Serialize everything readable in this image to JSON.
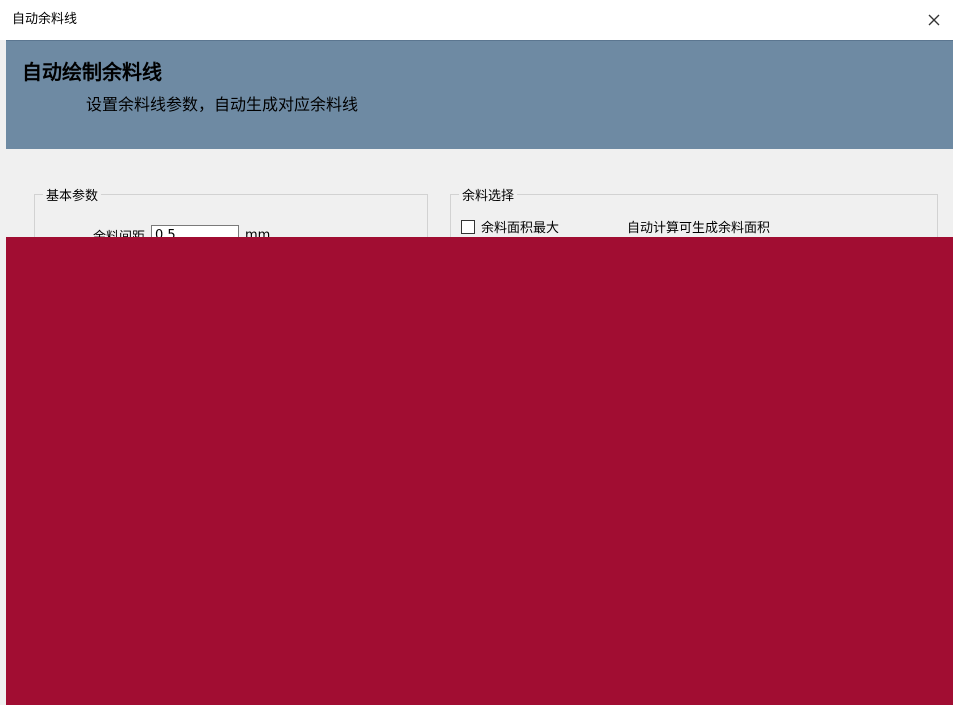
{
  "window": {
    "title": "自动余料线"
  },
  "icons": {
    "close": "close-icon",
    "checkbox": "checkbox-icon"
  },
  "banner": {
    "heading": "自动绘制余料线",
    "subheading": "设置余料线参数，自动生成对应余料线"
  },
  "basic_params": {
    "legend": "基本参数",
    "field_label": "余料间距",
    "field_value": "0.5",
    "unit": "mm"
  },
  "remnant_selection": {
    "legend": "余料选择",
    "checkbox_label": "余料面积最大",
    "checked": false,
    "hint": "自动计算可生成余料面积"
  },
  "colors": {
    "banner": "#6e8aa3",
    "window_bg": "#f0f0f0",
    "titlebar": "#ffffff",
    "corruption": "#a10d32"
  }
}
